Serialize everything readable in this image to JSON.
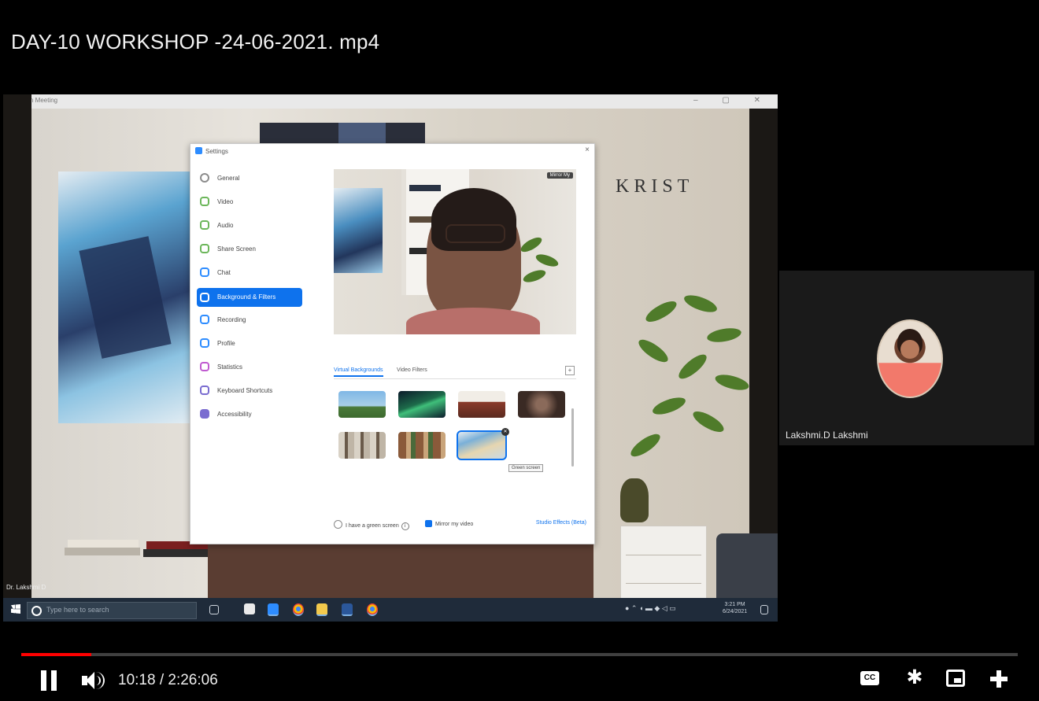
{
  "video": {
    "title": "DAY-10 WORKSHOP -24-06-2021. mp4",
    "current_time": "10:18",
    "duration": "2:26:06",
    "time_display": "10:18 / 2:26:06",
    "progress_fraction": 0.07
  },
  "player_controls": {
    "cc_label": "CC",
    "icons": [
      "pause-icon",
      "volume-icon",
      "captions-icon",
      "settings-gear-icon",
      "miniplayer-icon",
      "exit-fullscreen-icon"
    ],
    "accent_color": "#ff0000"
  },
  "shared_screen": {
    "window_title": "Zoom Meeting",
    "wall_text": "KRIST",
    "presenter_label": "Dr. Lakshmi D",
    "taskbar": {
      "search_placeholder": "Type here to search",
      "clock_time": "3:21 PM",
      "clock_date": "6/24/2021"
    },
    "settings": {
      "title": "Settings",
      "close": "×",
      "nav_items": [
        {
          "label": "General",
          "color": "#8c8c8c"
        },
        {
          "label": "Video",
          "color": "#6cb65a"
        },
        {
          "label": "Audio",
          "color": "#6cb65a"
        },
        {
          "label": "Share Screen",
          "color": "#6cb65a"
        },
        {
          "label": "Chat",
          "color": "#2d8cff"
        },
        {
          "label": "Background & Filters",
          "color": "#ffffff",
          "active": true
        },
        {
          "label": "Recording",
          "color": "#2d8cff"
        },
        {
          "label": "Profile",
          "color": "#2d8cff"
        },
        {
          "label": "Statistics",
          "color": "#c05ad0"
        },
        {
          "label": "Keyboard Shortcuts",
          "color": "#7a6cd0"
        },
        {
          "label": "Accessibility",
          "color": "#7a6cd0"
        }
      ],
      "preview_tag": "Mirror My",
      "tabs": {
        "virtual": "Virtual Backgrounds",
        "filters": "Video Filters"
      },
      "add_button": "+",
      "tooltip": "Green screen",
      "green_screen_label": "I have a green screen",
      "mirror_label": "Mirror my video",
      "studio_effects": "Studio Effects (Beta)"
    }
  },
  "participant": {
    "name": "Lakshmi.D Lakshmi",
    "tile_bg": "#1a1a1a"
  }
}
